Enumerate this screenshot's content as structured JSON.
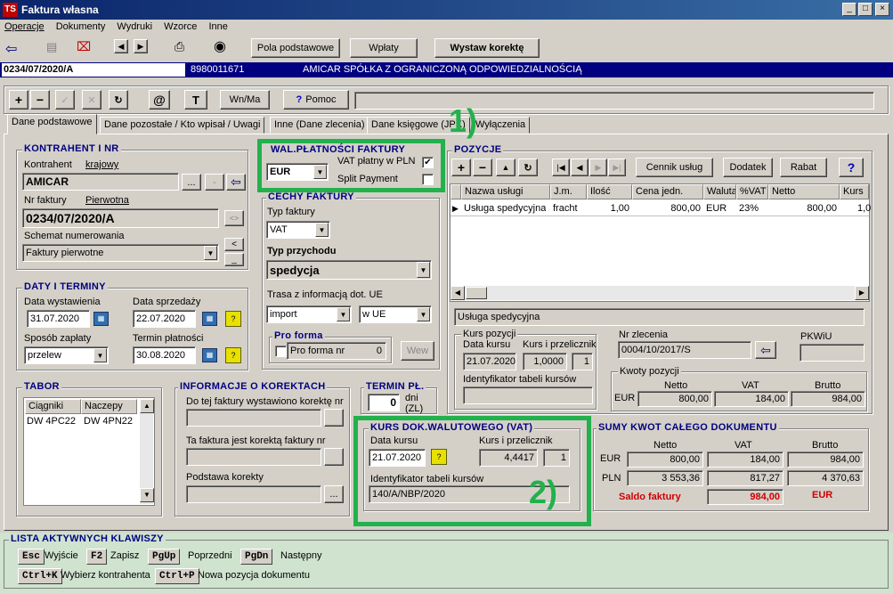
{
  "window": {
    "title": "Faktura własna",
    "icon": "TS"
  },
  "menu": [
    "Operacje",
    "Dokumenty",
    "Wydruki",
    "Wzorce",
    "Inne"
  ],
  "toolbar": {
    "pola": "Pola podstawowe",
    "wplaty": "Wpłaty",
    "korekta": "Wystaw korektę"
  },
  "docbar": {
    "number": "0234/07/2020/A",
    "nip": "8980011671",
    "name": "AMICAR SPÓŁKA Z OGRANICZONĄ ODPOWIEDZIALNOŚCIĄ"
  },
  "actions": {
    "wnma": "Wn/Ma",
    "pomoc": "Pomoc",
    "t": "T"
  },
  "tabs": [
    "Dane podstawowe",
    "Dane pozostałe / Kto wpisał / Uwagi",
    "Inne (Dane zlecenia)",
    "Dane księgowe (JPK)",
    "Wyłączenia"
  ],
  "kontrahent": {
    "title": "KONTRAHENT I NR",
    "label": "Kontrahent",
    "type": "krajowy",
    "value": "AMICAR",
    "nr_label": "Nr faktury",
    "nr_type": "Pierwotna",
    "nr": "0234/07/2020/A",
    "schemat_label": "Schemat numerowania",
    "schemat": "Faktury pierwotne"
  },
  "daty": {
    "title": "DATY I TERMINY",
    "wyst_label": "Data wystawienia",
    "wyst": "31.07.2020",
    "sprz_label": "Data sprzedaży",
    "sprz": "22.07.2020",
    "zapl_label": "Sposób zapłaty",
    "zapl": "przelew",
    "term_label": "Termin płatności",
    "term": "30.08.2020"
  },
  "tabor": {
    "title": "TABOR",
    "cols": [
      "Ciągniki",
      "Naczepy"
    ],
    "row": [
      "DW 4PC22",
      "DW 4PN22"
    ]
  },
  "korekty": {
    "title": "INFORMACJE O KOREKTACH",
    "l1": "Do tej faktury wystawiono korektę nr",
    "l2": "Ta faktura jest korektą faktury nr",
    "l3": "Podstawa korekty"
  },
  "termin": {
    "title": "TERMIN PŁ.",
    "value": "0",
    "unit": "dni",
    "unit2": "(ZL)"
  },
  "waluta": {
    "title": "WAL.PŁATNOŚCI FAKTURY",
    "currency": "EUR",
    "vat_pln": "VAT płatny w PLN",
    "split": "Split Payment"
  },
  "cechy": {
    "title": "CECHY FAKTURY",
    "typ_label": "Typ faktury",
    "typ": "VAT",
    "przych_label": "Typ przychodu",
    "przych": "spedycja",
    "trasa_label": "Trasa z informacją dot. UE",
    "trasa1": "import",
    "trasa2": "w UE",
    "proforma_title": "Pro forma",
    "proforma_label": "Pro forma nr",
    "proforma_nr": "0",
    "wew": "Wew"
  },
  "pozycje": {
    "title": "POZYCJE",
    "cennik": "Cennik usług",
    "dodatek": "Dodatek",
    "rabat": "Rabat",
    "cols": [
      "Nazwa usługi",
      "J.m.",
      "Ilość",
      "Cena jedn.",
      "Waluta",
      "%VAT",
      "Netto",
      "Kurs"
    ],
    "row": [
      "Usługa spedycyjna",
      "fracht",
      "1,00",
      "800,00",
      "EUR",
      "23%",
      "800,00",
      "1,0"
    ],
    "desc": "Usługa spedycyjna",
    "kurs_title": "Kurs pozycji",
    "kurs_data_label": "Data kursu",
    "kurs_data": "21.07.2020",
    "kurs_prz_label": "Kurs i przelicznik",
    "kurs": "1,0000",
    "przel": "1",
    "ident_label": "Identyfikator tabeli kursów",
    "zlec_label": "Nr zlecenia",
    "zlec": "0004/10/2017/S",
    "pkwiu": "PKWiU",
    "kwoty_title": "Kwoty pozycji",
    "k_netto": "Netto",
    "k_vat": "VAT",
    "k_brutto": "Brutto",
    "k_cur": "EUR",
    "k_n": "800,00",
    "k_v": "184,00",
    "k_b": "984,00"
  },
  "kursdok": {
    "title": "KURS DOK.WALUTOWEGO (VAT)",
    "data_label": "Data kursu",
    "data": "21.07.2020",
    "prz_label": "Kurs i przelicznik",
    "kurs": "4,4417",
    "przel": "1",
    "ident_label": "Identyfikator tabeli kursów",
    "ident": "140/A/NBP/2020"
  },
  "sumy": {
    "title": "SUMY KWOT CAŁEGO DOKUMENTU",
    "netto": "Netto",
    "vat": "VAT",
    "brutto": "Brutto",
    "eur": "EUR",
    "pln": "PLN",
    "eur_n": "800,00",
    "eur_v": "184,00",
    "eur_b": "984,00",
    "pln_n": "3 553,36",
    "pln_v": "817,27",
    "pln_b": "4 370,63",
    "saldo_label": "Saldo faktury",
    "saldo": "984,00",
    "saldo_cur": "EUR"
  },
  "keys": {
    "title": "LISTA AKTYWNYCH KLAWISZY",
    "items": [
      {
        "k": "Esc",
        "l": "Wyjście"
      },
      {
        "k": "F2",
        "l": "Zapisz"
      },
      {
        "k": "PgUp",
        "l": "Poprzedni"
      },
      {
        "k": "PgDn",
        "l": "Następny"
      },
      {
        "k": "Ctrl+K",
        "l": "Wybierz kontrahenta"
      },
      {
        "k": "Ctrl+P",
        "l": "Nowa pozycja dokumentu"
      }
    ]
  },
  "annotations": {
    "a1": "1)",
    "a2": "2)"
  }
}
